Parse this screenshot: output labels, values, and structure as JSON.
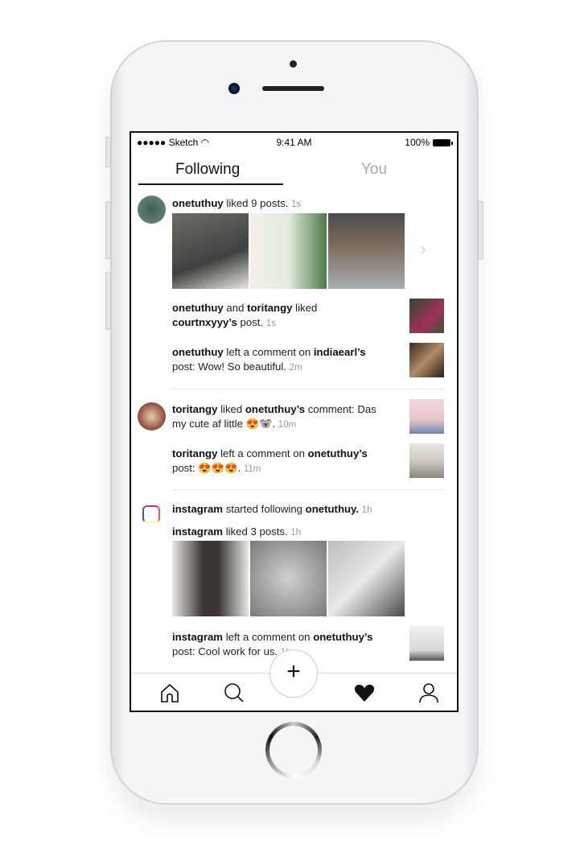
{
  "status_bar": {
    "carrier": "●●●●● Sketch",
    "time": "9:41 AM",
    "battery": "100%"
  },
  "tabs": [
    {
      "label": "Following",
      "active": true
    },
    {
      "label": "You",
      "active": false
    }
  ],
  "feed": [
    {
      "user": "onetuthuy",
      "action": " liked 9 posts. ",
      "time": "1s",
      "photos": 3
    },
    {
      "parts": [
        "onetuthuy",
        " and ",
        "toritangy",
        " liked ",
        "courtnxyyy’s",
        " post. "
      ],
      "time": "1s"
    },
    {
      "parts": [
        "onetuthuy",
        " left a comment on ",
        "indiaearl’s",
        " post: Wow! So beautiful. "
      ],
      "time": "2m"
    },
    {
      "parts": [
        "toritangy",
        " liked ",
        "onetuthuy’s",
        " comment: Das my cute af little "
      ],
      "emojis": "😍🐨",
      "suffix": ". ",
      "time": "10m"
    },
    {
      "parts": [
        "toritangy",
        " left a comment on ",
        "onetuthuy’s",
        " post: "
      ],
      "emojis": "😍😍😍",
      "suffix": ". ",
      "time": "11m"
    },
    {
      "parts": [
        "instagram",
        " started following ",
        "onetuthuy.",
        " "
      ],
      "time": "1h"
    },
    {
      "user": "instagram",
      "action": " liked 3 posts. ",
      "time": "1h",
      "photos": 3
    },
    {
      "parts": [
        "instagram",
        " left a comment on ",
        "onetuthuy’s",
        " post: Cool work for us. "
      ],
      "time": "1h"
    }
  ],
  "tabbar": {
    "items": [
      "home-icon",
      "search-icon",
      "add-icon",
      "heart-icon",
      "profile-icon"
    ],
    "plus": "+"
  }
}
